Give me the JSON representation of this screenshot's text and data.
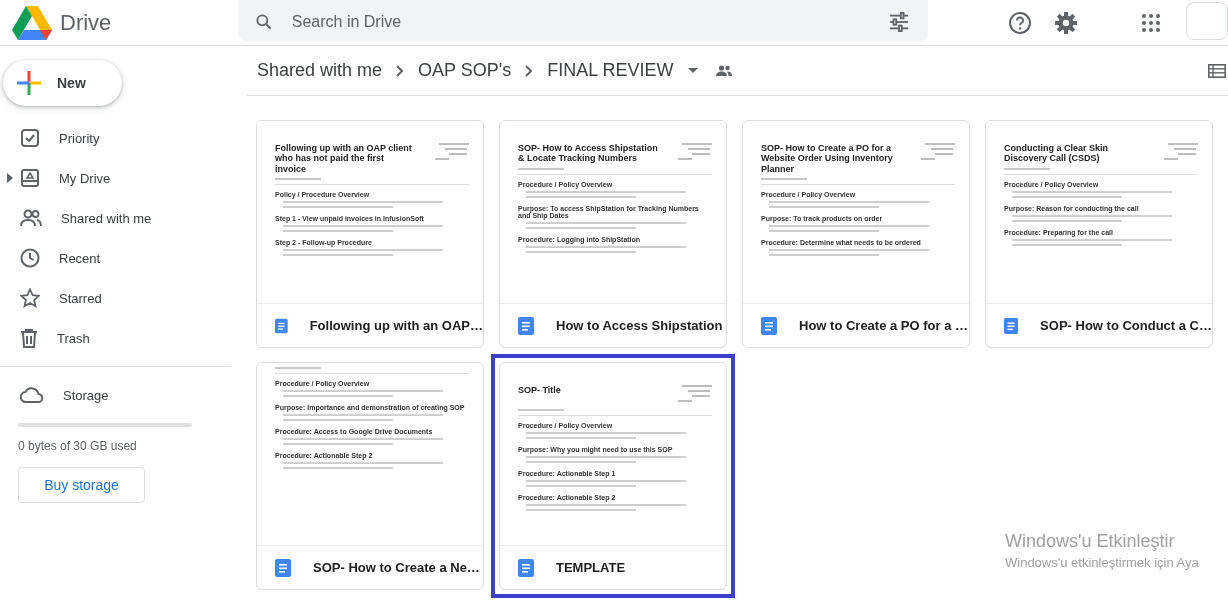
{
  "app": {
    "name": "Drive"
  },
  "search": {
    "placeholder": "Search in Drive"
  },
  "new_button": {
    "label": "New"
  },
  "nav": [
    {
      "label": "Priority",
      "selected": false,
      "has_children": false
    },
    {
      "label": "My Drive",
      "selected": false,
      "has_children": true
    },
    {
      "label": "Shared with me",
      "selected": false,
      "has_children": false
    },
    {
      "label": "Recent",
      "selected": false,
      "has_children": false
    },
    {
      "label": "Starred",
      "selected": false,
      "has_children": false
    },
    {
      "label": "Trash",
      "selected": false,
      "has_children": false
    }
  ],
  "storage": {
    "label": "Storage",
    "level": 0,
    "usage": "0 bytes of 30 GB used",
    "button": "Buy storage"
  },
  "breadcrumb": [
    "Shared with me",
    "OAP SOP's",
    "FINAL REVIEW"
  ],
  "files": [
    {
      "name": "Following up with an OAP…",
      "selected": false,
      "preview": {
        "title": "Following up with an OAP client who has not paid the first invoice",
        "sections": [
          "Policy / Procedure Overview",
          "Step 1 - View unpaid invoices in InfusionSoft",
          "Step 2 - Follow-up Procedure"
        ]
      }
    },
    {
      "name": "How to Access Shipstation",
      "selected": false,
      "preview": {
        "title": "SOP- How to Access Shipstation & Locate Tracking Numbers",
        "sections": [
          "Procedure / Policy Overview",
          "Purpose: To access ShipStation for Tracking Numbers and Ship Dates",
          "Procedure: Logging into ShipStation"
        ]
      }
    },
    {
      "name": "How to Create a PO for a …",
      "selected": false,
      "preview": {
        "title": "SOP- How to Create a PO for a Website Order Using Inventory Planner",
        "sections": [
          "Procedure / Policy Overview",
          "Purpose: To track products on order",
          "Procedure: Determine what needs to be ordered"
        ]
      }
    },
    {
      "name": "SOP- How to Conduct a C…",
      "selected": false,
      "preview": {
        "title": "Conducting a Clear Skin Discovery Call (CSDS)",
        "sections": [
          "Procedure / Policy Overview",
          "Purpose: Reason for conducting the call",
          "Procedure: Preparing for the call"
        ]
      }
    },
    {
      "name": "SOP- How to Create a Ne…",
      "selected": false,
      "preview": {
        "sections": [
          "Procedure / Policy Overview",
          "Purpose: Importance and demonstration of creating SOP",
          "Procedure: Access to Google Drive Documents",
          "Procedure: Actionable Step 2"
        ]
      }
    },
    {
      "name": "TEMPLATE",
      "selected": true,
      "preview": {
        "title": "SOP- Title",
        "sections": [
          "Procedure / Policy Overview",
          "Purpose: Why you might need to use this SOP",
          "Procedure: Actionable Step 1",
          "Procedure: Actionable Step 2"
        ]
      }
    }
  ],
  "activation_notice": {
    "title": "Windows'u Etkinleştir",
    "subtitle": "Windows'u etkinleştirmek için Aya"
  }
}
